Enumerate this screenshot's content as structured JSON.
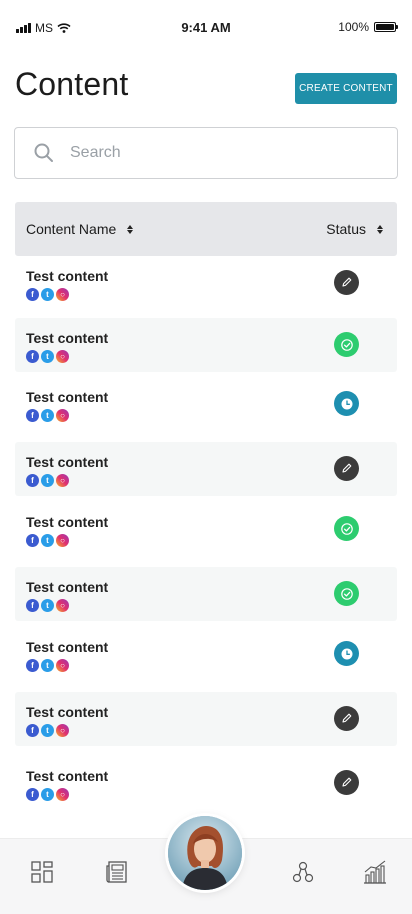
{
  "status_bar": {
    "carrier": "MS",
    "time": "9:41 AM",
    "battery": "100%"
  },
  "header": {
    "title": "Content",
    "create_label": "CREATE CONTENT"
  },
  "search": {
    "placeholder": "Search",
    "icon": "search-icon"
  },
  "table": {
    "columns": [
      "Content Name",
      "Status"
    ],
    "rows": [
      {
        "title": "Test content",
        "status": "draft"
      },
      {
        "title": "Test content",
        "status": "published"
      },
      {
        "title": "Test content",
        "status": "scheduled"
      },
      {
        "title": "Test content",
        "status": "draft"
      },
      {
        "title": "Test content",
        "status": "published"
      },
      {
        "title": "Test content",
        "status": "published"
      },
      {
        "title": "Test content",
        "status": "scheduled"
      },
      {
        "title": "Test content",
        "status": "draft"
      },
      {
        "title": "Test content",
        "status": "draft"
      }
    ],
    "social_icons": [
      "facebook-icon",
      "twitter-icon",
      "instagram-icon"
    ]
  },
  "status_icons": {
    "draft": "pencil-icon",
    "published": "check-circle-icon",
    "scheduled": "clock-icon"
  },
  "colors": {
    "accent": "#1f8fa9",
    "draft": "#3b3b3b",
    "published": "#2dcc6f",
    "scheduled": "#1e8fb0"
  },
  "bottom_nav": {
    "items": [
      "dashboard-icon",
      "content-icon",
      "profile-avatar",
      "audience-icon",
      "analytics-icon"
    ]
  }
}
